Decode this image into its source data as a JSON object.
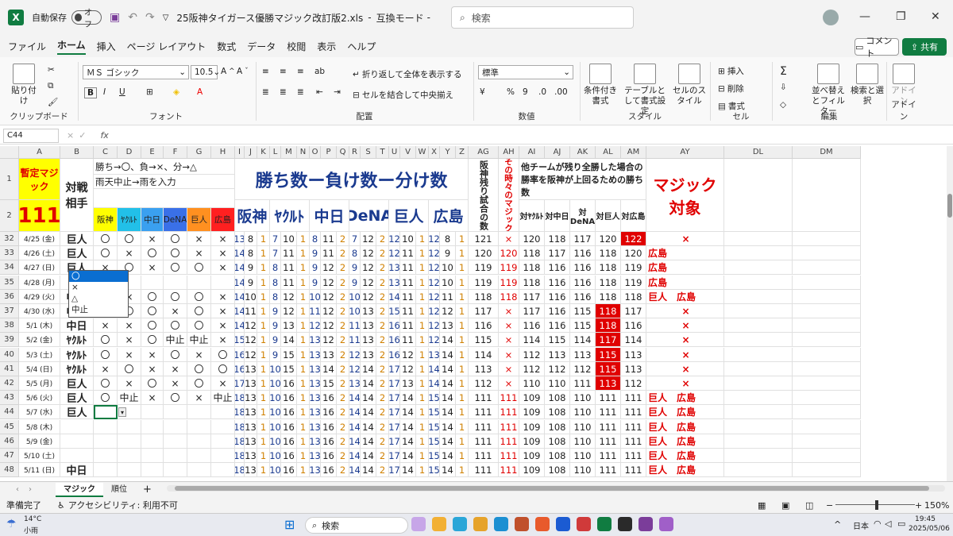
{
  "titlebar": {
    "autosave_label": "自動保存",
    "autosave_state": "オフ",
    "filename": "25阪神タイガース優勝マジック改訂版2.xls",
    "separator": "-",
    "mode": "互換モード",
    "mode_suffix": "-",
    "search_placeholder": "検索",
    "minimize": "—",
    "restore": "❐",
    "close": "✕"
  },
  "menu": {
    "items": [
      "ファイル",
      "ホーム",
      "挿入",
      "ページ レイアウト",
      "数式",
      "データ",
      "校閲",
      "表示",
      "ヘルプ"
    ],
    "comment": "コメント",
    "share": "共有"
  },
  "ribbon": {
    "clipboard": {
      "paste": "貼り付け",
      "label": "クリップボード"
    },
    "font": {
      "name": "ＭＳ ゴシック",
      "size": "10.5",
      "bold": "B",
      "italic": "I",
      "underline": "U",
      "label": "フォント"
    },
    "alignment": {
      "wrap": "折り返して全体を表示する",
      "merge": "セルを結合して中央揃え",
      "label": "配置"
    },
    "number": {
      "format": "標準",
      "label": "数値"
    },
    "styles": {
      "cond": "条件付き書式",
      "table": "テーブルとして書式設定",
      "cell": "セルのスタイル",
      "label": "スタイル"
    },
    "cells": {
      "insert": "挿入",
      "delete": "削除",
      "format": "書式",
      "label": "セル"
    },
    "editing": {
      "sort": "並べ替えとフィルター",
      "find": "検索と選択",
      "label": "編集"
    },
    "addin": {
      "name": "アドイン",
      "label": "アドイン"
    }
  },
  "formula_bar": {
    "name_box": "C44",
    "fx": "fx",
    "value": ""
  },
  "columns": [
    "A",
    "B",
    "C",
    "D",
    "E",
    "F",
    "G",
    "H",
    "I",
    "J",
    "K",
    "L",
    "M",
    "N",
    "O",
    "P",
    "Q",
    "R",
    "S",
    "T",
    "U",
    "V",
    "W",
    "X",
    "Y",
    "Z",
    "AG",
    "AH",
    "AI",
    "AJ",
    "AK",
    "AL",
    "AM",
    "AY",
    "DL",
    "DM"
  ],
  "header": {
    "magic_label": "暫定マジック",
    "magic_value": "111",
    "opponent_label": "対戦相手",
    "legend": "勝ち→〇、負→×、分→△",
    "legend2": "雨天中止→雨を入力",
    "teams_small": [
      "阪神",
      "ﾔｸﾙﾄ",
      "中日",
      "DeNA",
      "巨人",
      "広島"
    ],
    "wlt_title": "勝ち数ー負け数ー分け数",
    "teams_big": [
      "阪神",
      "ﾔｸﾙﾄ",
      "中日",
      "DeNA",
      "巨人",
      "広島"
    ],
    "remaining": "阪神残り試合の数",
    "magic_at_time": "その時々のマジック",
    "other_note": "他チームが残り全勝した場合の勝率を阪神が上回るための勝ち数",
    "vs_cols": [
      "対ﾔｸﾙﾄ",
      "対中日",
      "対DeNA",
      "対巨人",
      "対広島"
    ],
    "magic_target": "マジック対象",
    "row1": "1",
    "row2": "2"
  },
  "rows": [
    {
      "n": "32",
      "date": "4/25 (金)",
      "opp": "巨人",
      "r": [
        "〇",
        "〇",
        "×",
        "〇",
        "×",
        "×"
      ],
      "t": [
        [
          13,
          8,
          1
        ],
        [
          7,
          10,
          1
        ],
        [
          8,
          11,
          2
        ],
        [
          7,
          12,
          2
        ],
        [
          12,
          10,
          1
        ],
        [
          12,
          8,
          1
        ]
      ],
      "rem": "121",
      "mag": "×",
      "v": [
        "120",
        "118",
        "117",
        "120",
        "122"
      ],
      "tgt": "×",
      "hl": 4
    },
    {
      "n": "33",
      "date": "4/26 (土)",
      "opp": "巨人",
      "r": [
        "〇",
        "×",
        "〇",
        "〇",
        "×",
        "×"
      ],
      "t": [
        [
          14,
          8,
          1
        ],
        [
          7,
          11,
          1
        ],
        [
          9,
          11,
          2
        ],
        [
          8,
          12,
          2
        ],
        [
          12,
          11,
          1
        ],
        [
          12,
          9,
          1
        ]
      ],
      "rem": "120",
      "mag": "120",
      "v": [
        "118",
        "117",
        "116",
        "118",
        "120"
      ],
      "tgt": "広島",
      "hl": -1
    },
    {
      "n": "34",
      "date": "4/27 (日)",
      "opp": "巨人",
      "r": [
        "×",
        "〇",
        "×",
        "〇",
        "〇",
        "×"
      ],
      "t": [
        [
          14,
          9,
          1
        ],
        [
          8,
          11,
          1
        ],
        [
          9,
          12,
          2
        ],
        [
          9,
          12,
          2
        ],
        [
          13,
          11,
          1
        ],
        [
          12,
          10,
          1
        ]
      ],
      "rem": "119",
      "mag": "119",
      "v": [
        "118",
        "116",
        "116",
        "118",
        "119"
      ],
      "tgt": "広島",
      "hl": -1
    },
    {
      "n": "35",
      "date": "4/28 (月)",
      "opp": "",
      "r": [
        "",
        "",
        "",
        "",
        "",
        ""
      ],
      "t": [
        [
          14,
          9,
          1
        ],
        [
          8,
          11,
          1
        ],
        [
          9,
          12,
          2
        ],
        [
          9,
          12,
          2
        ],
        [
          13,
          11,
          1
        ],
        [
          12,
          10,
          1
        ]
      ],
      "rem": "119",
      "mag": "119",
      "v": [
        "118",
        "116",
        "116",
        "118",
        "119"
      ],
      "tgt": "広島",
      "hl": -1
    },
    {
      "n": "36",
      "date": "4/29 (火)",
      "opp": "中日",
      "r": [
        "×",
        "×",
        "〇",
        "〇",
        "〇",
        "×"
      ],
      "t": [
        [
          14,
          10,
          1
        ],
        [
          8,
          12,
          1
        ],
        [
          10,
          12,
          2
        ],
        [
          10,
          12,
          2
        ],
        [
          14,
          11,
          1
        ],
        [
          12,
          11,
          1
        ]
      ],
      "rem": "118",
      "mag": "118",
      "v": [
        "117",
        "116",
        "116",
        "118",
        "118"
      ],
      "tgt": "巨人　広島",
      "hl": -1
    },
    {
      "n": "37",
      "date": "4/30 (水)",
      "opp": "中日",
      "r": [
        "×",
        "〇",
        "〇",
        "×",
        "〇",
        "×"
      ],
      "t": [
        [
          14,
          11,
          1
        ],
        [
          9,
          12,
          1
        ],
        [
          11,
          12,
          2
        ],
        [
          10,
          13,
          2
        ],
        [
          15,
          11,
          1
        ],
        [
          12,
          12,
          1
        ]
      ],
      "rem": "117",
      "mag": "×",
      "v": [
        "117",
        "116",
        "115",
        "118",
        "117"
      ],
      "tgt": "×",
      "hl": 3
    },
    {
      "n": "38",
      "date": "5/1 (木)",
      "opp": "中日",
      "r": [
        "×",
        "×",
        "〇",
        "〇",
        "〇",
        "×"
      ],
      "t": [
        [
          14,
          12,
          1
        ],
        [
          9,
          13,
          1
        ],
        [
          12,
          12,
          2
        ],
        [
          11,
          13,
          2
        ],
        [
          16,
          11,
          1
        ],
        [
          12,
          13,
          1
        ]
      ],
      "rem": "116",
      "mag": "×",
      "v": [
        "116",
        "116",
        "115",
        "118",
        "116"
      ],
      "tgt": "×",
      "hl": 3
    },
    {
      "n": "39",
      "date": "5/2 (金)",
      "opp": "ﾔｸﾙﾄ",
      "r": [
        "〇",
        "×",
        "〇",
        "中止",
        "中止",
        "×"
      ],
      "t": [
        [
          15,
          12,
          1
        ],
        [
          9,
          14,
          1
        ],
        [
          13,
          12,
          2
        ],
        [
          11,
          13,
          2
        ],
        [
          16,
          11,
          1
        ],
        [
          12,
          14,
          1
        ]
      ],
      "rem": "115",
      "mag": "×",
      "v": [
        "114",
        "115",
        "114",
        "117",
        "114"
      ],
      "tgt": "×",
      "hl": 3
    },
    {
      "n": "40",
      "date": "5/3 (土)",
      "opp": "ﾔｸﾙﾄ",
      "r": [
        "〇",
        "×",
        "×",
        "〇",
        "×",
        "〇"
      ],
      "t": [
        [
          16,
          12,
          1
        ],
        [
          9,
          15,
          1
        ],
        [
          13,
          13,
          2
        ],
        [
          12,
          13,
          2
        ],
        [
          16,
          12,
          1
        ],
        [
          13,
          14,
          1
        ]
      ],
      "rem": "114",
      "mag": "×",
      "v": [
        "112",
        "113",
        "113",
        "115",
        "113"
      ],
      "tgt": "×",
      "hl": 3
    },
    {
      "n": "41",
      "date": "5/4 (日)",
      "opp": "ﾔｸﾙﾄ",
      "r": [
        "×",
        "〇",
        "×",
        "×",
        "〇",
        "〇"
      ],
      "t": [
        [
          16,
          13,
          1
        ],
        [
          10,
          15,
          1
        ],
        [
          13,
          14,
          2
        ],
        [
          12,
          14,
          2
        ],
        [
          17,
          12,
          1
        ],
        [
          14,
          14,
          1
        ]
      ],
      "rem": "113",
      "mag": "×",
      "v": [
        "112",
        "112",
        "112",
        "115",
        "113"
      ],
      "tgt": "×",
      "hl": 3
    },
    {
      "n": "42",
      "date": "5/5 (月)",
      "opp": "巨人",
      "r": [
        "〇",
        "×",
        "〇",
        "×",
        "〇",
        "×"
      ],
      "t": [
        [
          17,
          13,
          1
        ],
        [
          10,
          16,
          1
        ],
        [
          13,
          15,
          2
        ],
        [
          13,
          14,
          2
        ],
        [
          17,
          13,
          1
        ],
        [
          14,
          14,
          1
        ]
      ],
      "rem": "112",
      "mag": "×",
      "v": [
        "110",
        "110",
        "111",
        "113",
        "112"
      ],
      "tgt": "×",
      "hl": 3
    },
    {
      "n": "43",
      "date": "5/6 (火)",
      "opp": "巨人",
      "r": [
        "〇",
        "中止",
        "×",
        "〇",
        "×",
        "中止"
      ],
      "t": [
        [
          18,
          13,
          1
        ],
        [
          10,
          16,
          1
        ],
        [
          13,
          16,
          2
        ],
        [
          14,
          14,
          2
        ],
        [
          17,
          14,
          1
        ],
        [
          15,
          14,
          1
        ]
      ],
      "rem": "111",
      "mag": "111",
      "v": [
        "109",
        "108",
        "110",
        "111",
        "111"
      ],
      "tgt": "巨人　広島",
      "hl": -1
    },
    {
      "n": "44",
      "date": "5/7 (水)",
      "opp": "巨人",
      "r": [
        "",
        "",
        "",
        "",
        "",
        ""
      ],
      "t": [
        [
          18,
          13,
          1
        ],
        [
          10,
          16,
          1
        ],
        [
          13,
          16,
          2
        ],
        [
          14,
          14,
          2
        ],
        [
          17,
          14,
          1
        ],
        [
          15,
          14,
          1
        ]
      ],
      "rem": "111",
      "mag": "111",
      "v": [
        "109",
        "108",
        "110",
        "111",
        "111"
      ],
      "tgt": "巨人　広島",
      "hl": -1
    },
    {
      "n": "45",
      "date": "5/8 (木)",
      "opp": "",
      "r": [
        "",
        "",
        "",
        "",
        "",
        ""
      ],
      "t": [
        [
          18,
          13,
          1
        ],
        [
          10,
          16,
          1
        ],
        [
          13,
          16,
          2
        ],
        [
          14,
          14,
          2
        ],
        [
          17,
          14,
          1
        ],
        [
          15,
          14,
          1
        ]
      ],
      "rem": "111",
      "mag": "111",
      "v": [
        "109",
        "108",
        "110",
        "111",
        "111"
      ],
      "tgt": "巨人　広島",
      "hl": -1
    },
    {
      "n": "46",
      "date": "5/9 (金)",
      "opp": "",
      "r": [
        "",
        "",
        "",
        "",
        "",
        ""
      ],
      "t": [
        [
          18,
          13,
          1
        ],
        [
          10,
          16,
          1
        ],
        [
          13,
          16,
          2
        ],
        [
          14,
          14,
          2
        ],
        [
          17,
          14,
          1
        ],
        [
          15,
          14,
          1
        ]
      ],
      "rem": "111",
      "mag": "111",
      "v": [
        "109",
        "108",
        "110",
        "111",
        "111"
      ],
      "tgt": "巨人　広島",
      "hl": -1
    },
    {
      "n": "47",
      "date": "5/10 (土)",
      "opp": "",
      "r": [
        "",
        "",
        "",
        "",
        "",
        ""
      ],
      "t": [
        [
          18,
          13,
          1
        ],
        [
          10,
          16,
          1
        ],
        [
          13,
          16,
          2
        ],
        [
          14,
          14,
          2
        ],
        [
          17,
          14,
          1
        ],
        [
          15,
          14,
          1
        ]
      ],
      "rem": "111",
      "mag": "111",
      "v": [
        "109",
        "108",
        "110",
        "111",
        "111"
      ],
      "tgt": "巨人　広島",
      "hl": -1
    },
    {
      "n": "48",
      "date": "5/11 (日)",
      "opp": "中日",
      "r": [
        "",
        "",
        "",
        "",
        "",
        ""
      ],
      "t": [
        [
          18,
          13,
          1
        ],
        [
          10,
          16,
          1
        ],
        [
          13,
          16,
          2
        ],
        [
          14,
          14,
          2
        ],
        [
          17,
          14,
          1
        ],
        [
          15,
          14,
          1
        ]
      ],
      "rem": "111",
      "mag": "111",
      "v": [
        "109",
        "108",
        "110",
        "111",
        "111"
      ],
      "tgt": "巨人　広島",
      "hl": -1
    }
  ],
  "dropdown_options": [
    "〇",
    "×",
    "△",
    "中止"
  ],
  "sheet_tabs": [
    "マジック",
    "順位"
  ],
  "add_sheet": "+",
  "status": {
    "ready": "準備完了",
    "accessibility": "アクセシビリティ: 利用不可",
    "zoom": "150%",
    "minus": "−",
    "plus": "+"
  },
  "taskbar": {
    "weather_temp": "14°C",
    "weather_desc": "小雨",
    "search": "検索",
    "ime": "日本",
    "time": "19:45",
    "date": "2025/05/06"
  },
  "colors": {
    "excel_green": "#107c41",
    "magic_yellow": "#ffff00",
    "magic_red": "#e00000",
    "highlight_red": "#e00000"
  }
}
